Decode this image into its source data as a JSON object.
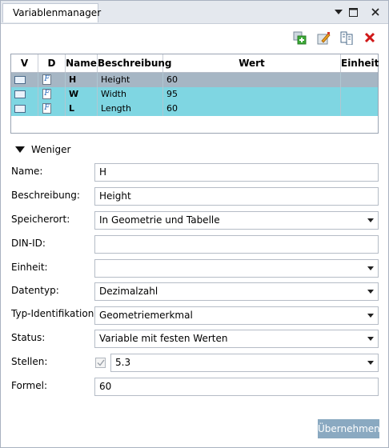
{
  "window": {
    "title": "Variablenmanager"
  },
  "toolbar": {
    "icons": [
      "add-variable-icon",
      "edit-variable-icon",
      "copy-variable-icon",
      "delete-variable-icon"
    ]
  },
  "grid": {
    "columns": [
      "V",
      "D",
      "Name",
      "Beschreibung",
      "Wert",
      "Einheit"
    ],
    "rows": [
      {
        "name": "H",
        "beschreibung": "Height",
        "wert": "60",
        "einheit": "",
        "selected": true
      },
      {
        "name": "W",
        "beschreibung": "Width",
        "wert": "95",
        "einheit": ""
      },
      {
        "name": "L",
        "beschreibung": "Length",
        "wert": "60",
        "einheit": ""
      }
    ],
    "d_glyph": "F"
  },
  "toggle": {
    "label": "Weniger"
  },
  "form": {
    "name_label": "Name:",
    "name_value": "H",
    "beschreibung_label": "Beschreibung:",
    "beschreibung_value": "Height",
    "speicherort_label": "Speicherort:",
    "speicherort_value": "In Geometrie und Tabelle",
    "din_label": "DIN-ID:",
    "din_value": "",
    "einheit_label": "Einheit:",
    "einheit_value": "",
    "datentyp_label": "Datentyp:",
    "datentyp_value": "Dezimalzahl",
    "typ_label": "Typ-Identifikation:",
    "typ_value": "Geometriemerkmal",
    "status_label": "Status:",
    "status_value": "Variable mit festen Werten",
    "stellen_label": "Stellen:",
    "stellen_value": "5.3",
    "formel_label": "Formel:",
    "formel_value": "60"
  },
  "buttons": {
    "apply": "Übernehmen"
  },
  "colors": {
    "selected_row": "#a6b6c4",
    "row": "#7fd6e2",
    "apply_button": "#8aa9c1"
  }
}
